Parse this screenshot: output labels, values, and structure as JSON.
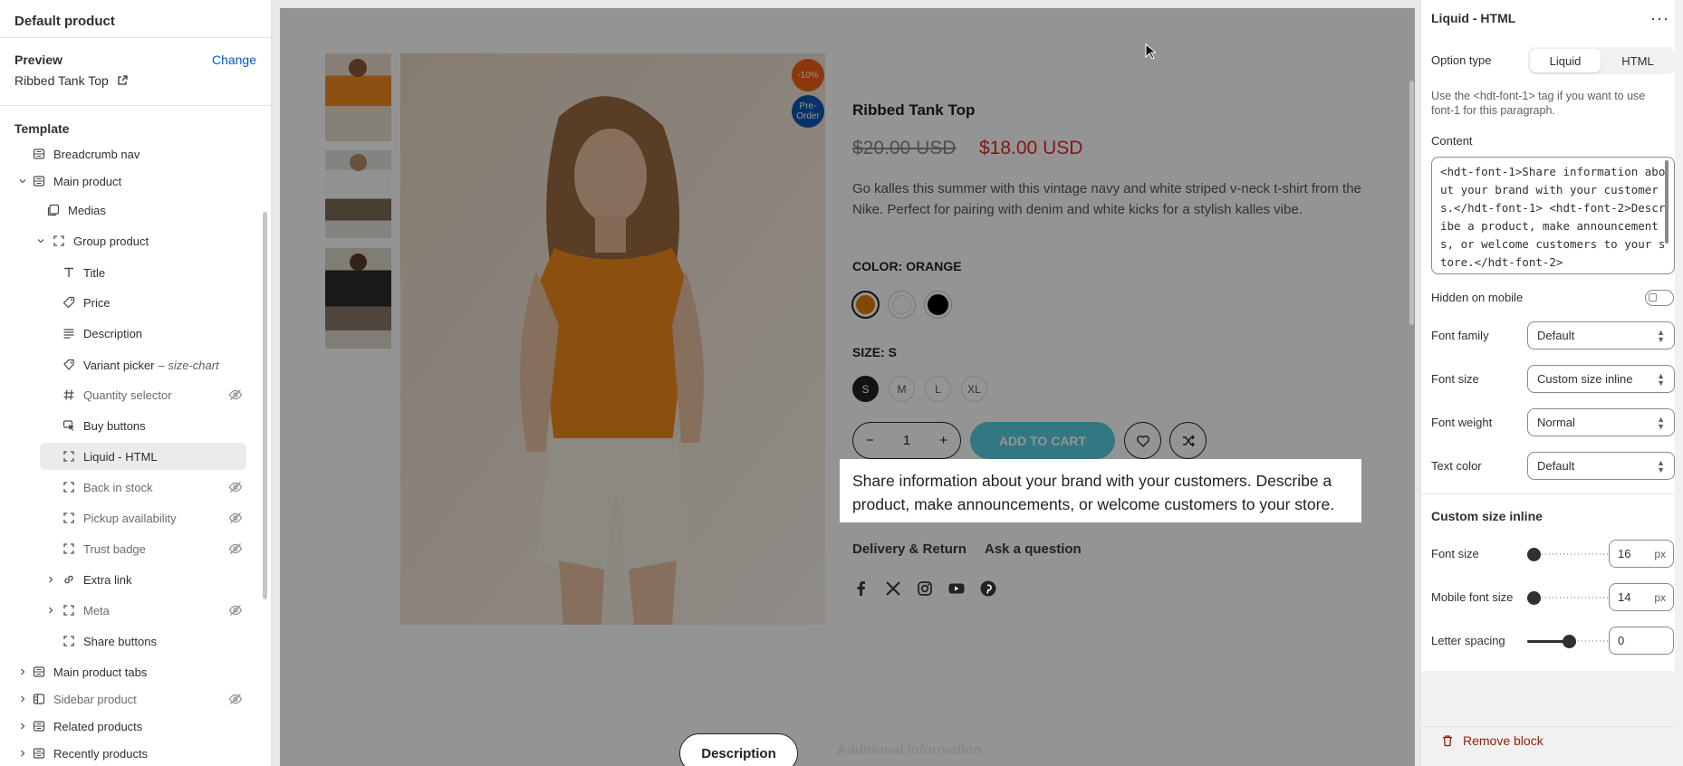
{
  "left": {
    "title": "Default product",
    "preview_label": "Preview",
    "change_label": "Change",
    "preview_product": "Ribbed Tank Top",
    "template_label": "Template",
    "items": [
      {
        "label": "Breadcrumb nav",
        "icon": "section-icon"
      },
      {
        "label": "Main product",
        "icon": "section-icon"
      },
      {
        "label": "Medias",
        "icon": "media-icon"
      },
      {
        "label": "Group product",
        "icon": "block-icon"
      },
      {
        "label": "Title",
        "icon": "text-icon"
      },
      {
        "label": "Price",
        "icon": "price-icon"
      },
      {
        "label": "Description",
        "icon": "lines-icon"
      },
      {
        "label": "Variant picker",
        "sub": "– size-chart",
        "icon": "variant-icon"
      },
      {
        "label": "Quantity selector",
        "icon": "hash-icon",
        "hidden": true
      },
      {
        "label": "Buy buttons",
        "icon": "cursor-icon"
      },
      {
        "label": "Liquid - HTML",
        "icon": "block-icon"
      },
      {
        "label": "Back in stock",
        "icon": "block-icon",
        "hidden": true
      },
      {
        "label": "Pickup availability",
        "icon": "block-icon",
        "hidden": true
      },
      {
        "label": "Trust badge",
        "icon": "block-icon",
        "hidden": true
      },
      {
        "label": "Extra link",
        "icon": "link-icon"
      },
      {
        "label": "Meta",
        "icon": "block-icon",
        "hidden": true
      },
      {
        "label": "Share buttons",
        "icon": "block-icon"
      },
      {
        "label": "Main product tabs",
        "icon": "section-icon"
      },
      {
        "label": "Sidebar product",
        "icon": "sidebar-icon",
        "hidden": true
      },
      {
        "label": "Related products",
        "icon": "section-icon"
      },
      {
        "label": "Recently products",
        "icon": "section-icon"
      }
    ]
  },
  "product": {
    "discount_badge": "-10%",
    "preorder_badge": "Pre-Order",
    "title": "Ribbed Tank Top",
    "old_price": "$20.00 USD",
    "new_price": "$18.00 USD",
    "description": "Go kalles this summer with this vintage navy and white striped v-neck t-shirt from the Nike. Perfect for pairing with denim and white kicks for a stylish kalles vibe.",
    "color_label": "COLOR: ORANGE",
    "colors": [
      "#e07b00",
      "#ffffff",
      "#000000"
    ],
    "size_label": "SIZE: S",
    "sizes": [
      "S",
      "M",
      "L",
      "XL"
    ],
    "quantity": "1",
    "add_to_cart": "ADD TO CART",
    "liquid_text": "Share information about your brand with your customers. Describe a product, make announcements, or welcome customers to your store.",
    "delivery_link": "Delivery & Return",
    "ask_link": "Ask a question",
    "tab_description": "Description",
    "tab_additional": "Additional Information"
  },
  "panel": {
    "title": "Liquid - HTML",
    "option_type_label": "Option type",
    "option_liquid": "Liquid",
    "option_html": "HTML",
    "help_text": "Use the <hdt-font-1> tag if you want to use font-1 for this paragraph.",
    "content_label": "Content",
    "content_value": "<hdt-font-1>Share information about your brand with your customers.</hdt-font-1> <hdt-font-2>Describe a product, make announcements, or welcome customers to your store.</hdt-font-2>",
    "hidden_mobile_label": "Hidden on mobile",
    "font_family_label": "Font family",
    "font_family_value": "Default",
    "font_size_label": "Font size",
    "font_size_value": "Custom size inline",
    "font_weight_label": "Font weight",
    "font_weight_value": "Normal",
    "text_color_label": "Text color",
    "text_color_value": "Default",
    "custom_size_heading": "Custom size inline",
    "cs_font_size_label": "Font size",
    "cs_font_size_value": "16",
    "cs_font_size_fill": 0.08,
    "mobile_font_size_label": "Mobile font size",
    "mobile_font_size_value": "14",
    "mobile_font_size_fill": 0.08,
    "letter_spacing_label": "Letter spacing",
    "letter_spacing_value": "0",
    "letter_spacing_fill": 0.5,
    "unit": "px",
    "remove_label": "Remove block"
  }
}
